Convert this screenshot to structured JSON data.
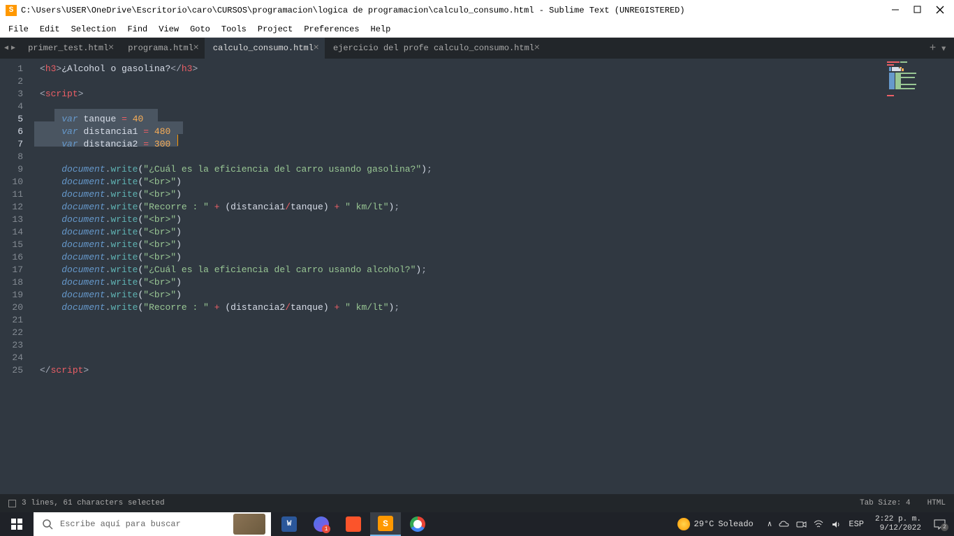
{
  "titlebar": {
    "icon_letter": "S",
    "path": "C:\\Users\\USER\\OneDrive\\Escritorio\\caro\\CURSOS\\programacion\\logica de programacion\\calculo_consumo.html - Sublime Text (UNREGISTERED)"
  },
  "menu": [
    "File",
    "Edit",
    "Selection",
    "Find",
    "View",
    "Goto",
    "Tools",
    "Project",
    "Preferences",
    "Help"
  ],
  "tabs": [
    {
      "label": "primer_test.html",
      "active": false
    },
    {
      "label": "programa.html",
      "active": false
    },
    {
      "label": "calculo_consumo.html",
      "active": true
    },
    {
      "label": "ejercicio del profe calculo_consumo.html",
      "active": false
    }
  ],
  "code": {
    "lines": 25,
    "selected_lines": [
      5,
      6,
      7
    ],
    "l1": {
      "t1": "<",
      "t2": "h3",
      "t3": ">",
      "t4": "¿Alcohol o gasolina?",
      "t5": "</",
      "t6": "h3",
      "t7": ">"
    },
    "l3": {
      "t1": "<",
      "t2": "script",
      "t3": ">"
    },
    "l5": {
      "indent": "    ",
      "kw": "var",
      "sp": " ",
      "v": "tanque",
      "sp2": " ",
      "eq": "=",
      "sp3": " ",
      "n": "40"
    },
    "l6": {
      "indent": "    ",
      "kw": "var",
      "sp": " ",
      "v": "distancia1",
      "sp2": " ",
      "eq": "=",
      "sp3": " ",
      "n": "480"
    },
    "l7": {
      "indent": "    ",
      "kw": "var",
      "sp": " ",
      "v": "distancia2",
      "sp2": " ",
      "eq": "=",
      "sp3": " ",
      "n": "300"
    },
    "l9": {
      "indent": "    ",
      "obj": "document",
      "dot": ".",
      "fn": "write",
      "p1": "(",
      "q1": "\"",
      "s": "¿Cuál es la eficiencia del carro usando gasolina?",
      "q2": "\"",
      "p2": ")",
      "sc": ";"
    },
    "l10": {
      "indent": "    ",
      "obj": "document",
      "dot": ".",
      "fn": "write",
      "p1": "(",
      "q1": "\"",
      "s": "<br>",
      "q2": "\"",
      "p2": ")"
    },
    "l11": {
      "indent": "    ",
      "obj": "document",
      "dot": ".",
      "fn": "write",
      "p1": "(",
      "q1": "\"",
      "s": "<br>",
      "q2": "\"",
      "p2": ")"
    },
    "l12": {
      "indent": "    ",
      "obj": "document",
      "dot": ".",
      "fn": "write",
      "p1": "(",
      "q1": "\"",
      "s": "Recorre : ",
      "q2": "\"",
      "sp": " ",
      "op1": "+",
      "sp2": " ",
      "p3": "(",
      "v1": "distancia1",
      "op2": "/",
      "v2": "tanque",
      "p4": ")",
      "sp3": " ",
      "op3": "+",
      "sp4": " ",
      "q3": "\"",
      "s2": " km/lt",
      "q4": "\"",
      "p2": ")",
      "sc": ";"
    },
    "l13": {
      "indent": "    ",
      "obj": "document",
      "dot": ".",
      "fn": "write",
      "p1": "(",
      "q1": "\"",
      "s": "<br>",
      "q2": "\"",
      "p2": ")"
    },
    "l14": {
      "indent": "    ",
      "obj": "document",
      "dot": ".",
      "fn": "write",
      "p1": "(",
      "q1": "\"",
      "s": "<br>",
      "q2": "\"",
      "p2": ")"
    },
    "l15": {
      "indent": "    ",
      "obj": "document",
      "dot": ".",
      "fn": "write",
      "p1": "(",
      "q1": "\"",
      "s": "<br>",
      "q2": "\"",
      "p2": ")"
    },
    "l16": {
      "indent": "    ",
      "obj": "document",
      "dot": ".",
      "fn": "write",
      "p1": "(",
      "q1": "\"",
      "s": "<br>",
      "q2": "\"",
      "p2": ")"
    },
    "l17": {
      "indent": "    ",
      "obj": "document",
      "dot": ".",
      "fn": "write",
      "p1": "(",
      "q1": "\"",
      "s": "¿Cuál es la eficiencia del carro usando alcohol?",
      "q2": "\"",
      "p2": ")",
      "sc": ";"
    },
    "l18": {
      "indent": "    ",
      "obj": "document",
      "dot": ".",
      "fn": "write",
      "p1": "(",
      "q1": "\"",
      "s": "<br>",
      "q2": "\"",
      "p2": ")"
    },
    "l19": {
      "indent": "    ",
      "obj": "document",
      "dot": ".",
      "fn": "write",
      "p1": "(",
      "q1": "\"",
      "s": "<br>",
      "q2": "\"",
      "p2": ")"
    },
    "l20": {
      "indent": "    ",
      "obj": "document",
      "dot": ".",
      "fn": "write",
      "p1": "(",
      "q1": "\"",
      "s": "Recorre : ",
      "q2": "\"",
      "sp": " ",
      "op1": "+",
      "sp2": " ",
      "p3": "(",
      "v1": "distancia2",
      "op2": "/",
      "v2": "tanque",
      "p4": ")",
      "sp3": " ",
      "op3": "+",
      "sp4": " ",
      "q3": "\"",
      "s2": " km/lt",
      "q4": "\"",
      "p2": ")",
      "sc": ";"
    },
    "l25": {
      "t1": "</",
      "t2": "script",
      "t3": ">"
    }
  },
  "status": {
    "selection": "3 lines, 61 characters selected",
    "tabsize": "Tab Size: 4",
    "syntax": "HTML"
  },
  "taskbar": {
    "search_placeholder": "Escribe aquí para buscar",
    "weather_temp": "29°C",
    "weather_desc": "Soleado",
    "lang": "ESP",
    "time": "2:22 p. m.",
    "date": "9/12/2022",
    "notif_count": "2"
  }
}
